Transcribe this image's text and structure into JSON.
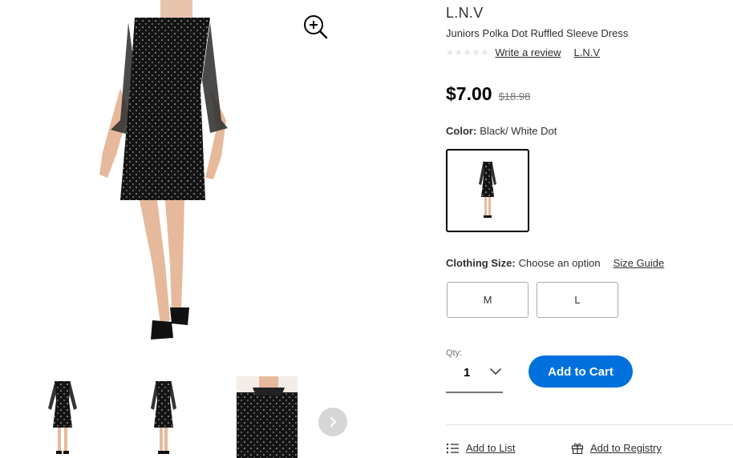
{
  "product": {
    "brand": "L.N.V",
    "name": "Juniors Polka Dot Ruffled Sleeve Dress",
    "rating": 0,
    "write_review_label": "Write a review",
    "brand_link": "L.N.V"
  },
  "pricing": {
    "current": "$7.00",
    "was": "$18.98"
  },
  "color": {
    "label": "Color:",
    "value": "Black/ White Dot"
  },
  "size": {
    "label": "Clothing Size:",
    "prompt": "Choose an option",
    "guide_label": "Size Guide",
    "options": [
      "M",
      "L"
    ]
  },
  "quantity": {
    "label": "Qty:",
    "value": "1"
  },
  "actions": {
    "add_to_cart": "Add to Cart",
    "add_to_list": "Add to List",
    "add_to_registry": "Add to Registry"
  },
  "icons": {
    "zoom": "zoom-in-icon",
    "next": "chevron-right-icon",
    "qty_dropdown": "chevron-down-icon",
    "list": "list-icon",
    "registry": "gift-icon"
  },
  "colors": {
    "accent": "#0071dc",
    "text": "#2e2f32",
    "muted": "#74767c"
  }
}
